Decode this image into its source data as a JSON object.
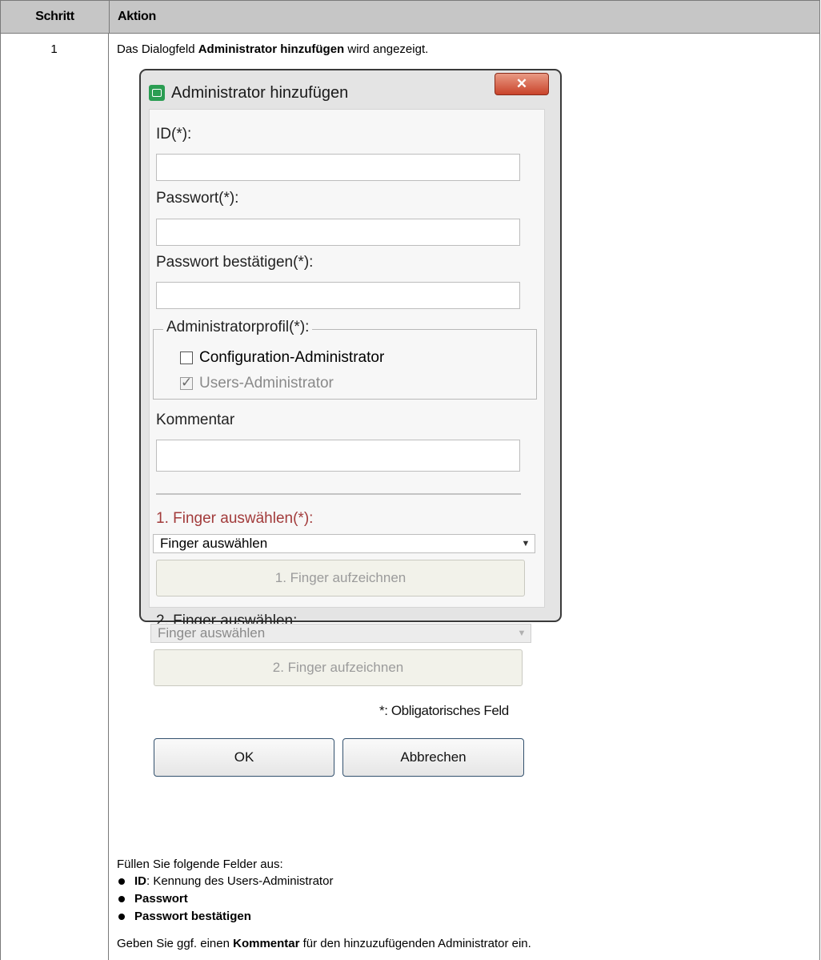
{
  "table": {
    "header_step": "Schritt",
    "header_action": "Aktion",
    "step_number": "1",
    "intro_before": "Das Dialogfeld ",
    "intro_bold": "Administrator hinzufügen",
    "intro_after": " wird angezeigt."
  },
  "dialog": {
    "title": "Administrator hinzufügen",
    "close_label": "✕",
    "id_label": "ID(*):",
    "id_value": "",
    "password_label": "Passwort(*):",
    "password_value": "",
    "confirm_label": "Passwort bestätigen(*):",
    "confirm_value": "",
    "profile_legend": "Administratorprofil(*):",
    "profiles": [
      {
        "label": "Configuration-Administrator",
        "checked": false,
        "enabled": true
      },
      {
        "label": "Users-Administrator",
        "checked": true,
        "enabled": false
      }
    ],
    "comment_label": "Kommentar",
    "comment_value": "",
    "finger1_label": "1. Finger auswählen(*):",
    "finger1_select": "Finger auswählen",
    "finger1_button": "1. Finger aufzeichnen",
    "finger2_label": "2. Finger auswählen:",
    "finger2_select": "Finger auswählen",
    "finger2_button": "2. Finger aufzeichnen",
    "mandatory_note": "*: Obligatorisches Feld",
    "ok_label": "OK",
    "cancel_label": "Abbrechen"
  },
  "instructions": {
    "fill_intro": "Füllen Sie folgende Felder aus:",
    "bullet1_bold": "ID",
    "bullet1_rest": ": Kennung des Users-Administrator",
    "bullet2_bold": "Passwort",
    "bullet3_bold": "Passwort bestätigen",
    "comment_before": "Geben Sie ggf. einen ",
    "comment_bold": "Kommentar",
    "comment_after": " für den hinzuzufügenden Administrator ein."
  }
}
